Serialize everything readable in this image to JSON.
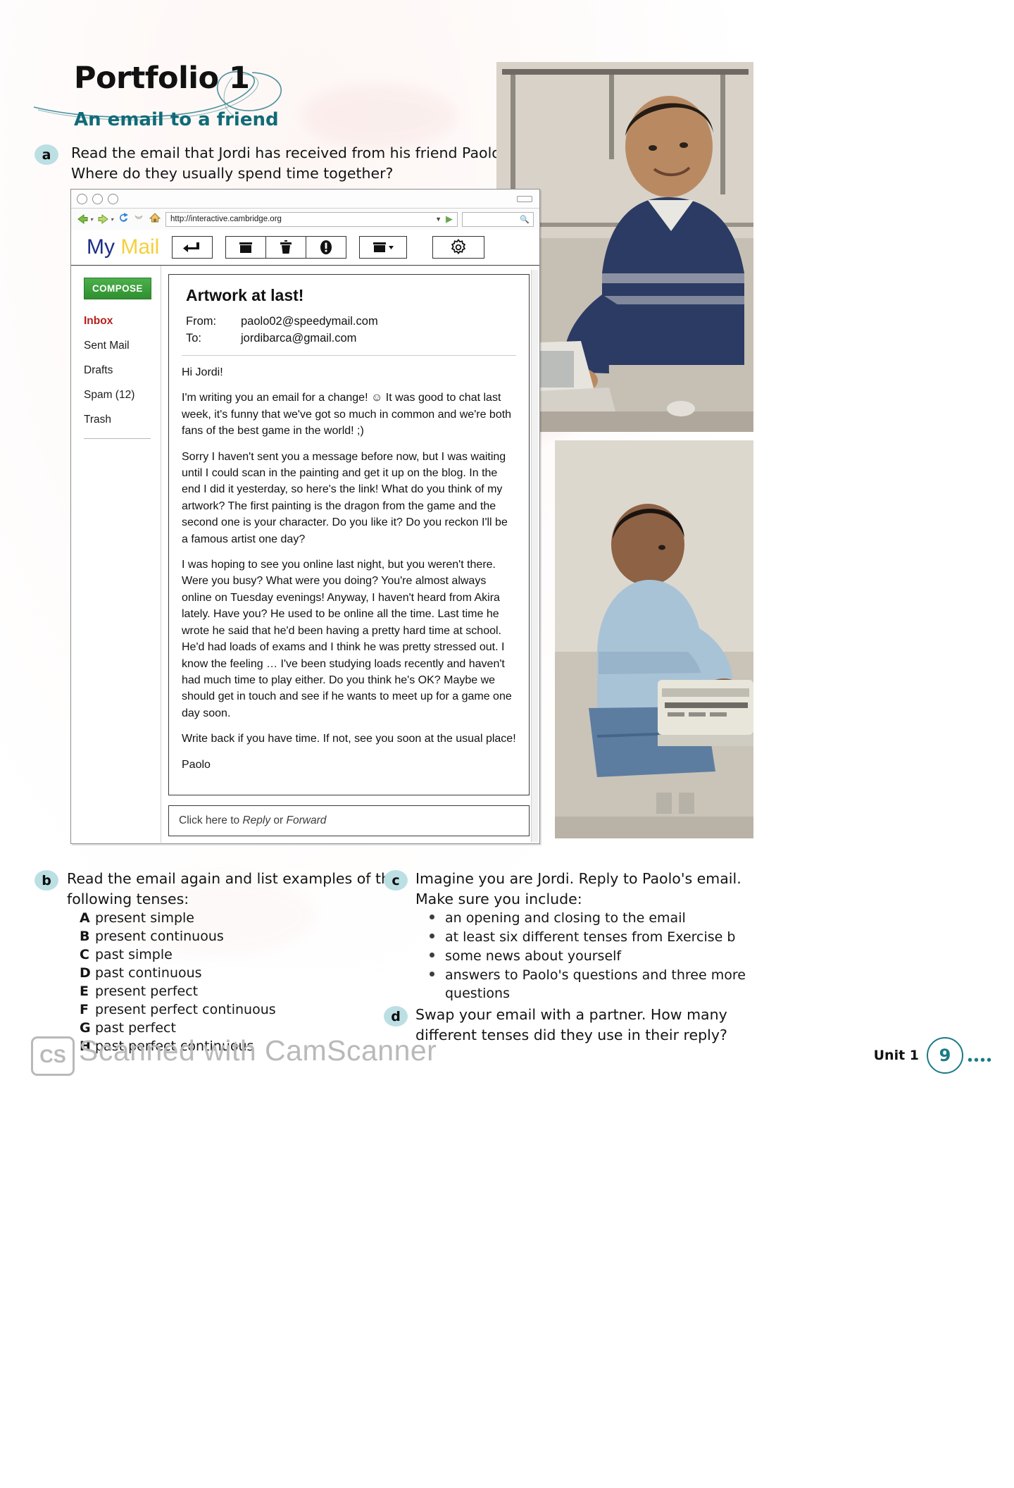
{
  "header": {
    "title": "Portfolio 1",
    "subtitle": "An email to a friend"
  },
  "exercises": {
    "a": {
      "label": "a",
      "line1": "Read the email that Jordi has received from his friend Paolo.",
      "line2": "Where do they usually spend time together?"
    },
    "b": {
      "label": "b",
      "line1": "Read the email again and list examples of the",
      "line2": "following tenses:",
      "items": [
        {
          "letter": "A",
          "text": "present simple"
        },
        {
          "letter": "B",
          "text": "present continuous"
        },
        {
          "letter": "C",
          "text": "past simple"
        },
        {
          "letter": "D",
          "text": "past continuous"
        },
        {
          "letter": "E",
          "text": "present perfect"
        },
        {
          "letter": "F",
          "text": "present perfect continuous"
        },
        {
          "letter": "G",
          "text": "past perfect"
        },
        {
          "letter": "H",
          "text": "past perfect continuous"
        }
      ]
    },
    "c": {
      "label": "c",
      "line1": "Imagine you are Jordi. Reply to Paolo's email.",
      "line2": "Make sure you include:",
      "bullets": [
        "an opening and closing to the email",
        "at least six different tenses from Exercise b",
        "some news about yourself",
        "answers to Paolo's questions and three more",
        "questions"
      ]
    },
    "d": {
      "label": "d",
      "line1": "Swap your email with a partner. How many",
      "line2": "different tenses did they use in their reply?"
    }
  },
  "browser": {
    "url": "http://interactive.cambridge.org",
    "back_icon": "back-arrow-icon",
    "forward_icon": "forward-arrow-icon",
    "reload_icon": "reload-icon",
    "stop_icon": "stop-icon",
    "home_icon": "home-icon",
    "search_icon": "search-icon",
    "url_dropdown_icon": "chevron-down-icon",
    "go_icon": "go-arrow-icon"
  },
  "mail": {
    "logo_first": "My",
    "logo_second": "Mail",
    "toolbar_buttons": [
      {
        "name": "reply-button",
        "icon": "reply-arrow-icon"
      },
      {
        "name": "archive-button",
        "icon": "archive-box-icon"
      },
      {
        "name": "delete-button",
        "icon": "trash-icon"
      },
      {
        "name": "spam-button",
        "icon": "exclamation-icon"
      },
      {
        "name": "move-to-button",
        "icon": "folder-dropdown-icon"
      },
      {
        "name": "settings-button",
        "icon": "gear-icon"
      }
    ],
    "compose_label": "COMPOSE",
    "folders": [
      {
        "label": "Inbox",
        "active": true
      },
      {
        "label": "Sent Mail",
        "active": false
      },
      {
        "label": "Drafts",
        "active": false
      },
      {
        "label": "Spam (12)",
        "active": false
      },
      {
        "label": "Trash",
        "active": false
      }
    ],
    "email": {
      "subject": "Artwork at last!",
      "from_label": "From:",
      "from_value": "paolo02@speedymail.com",
      "to_label": "To:",
      "to_value": "jordibarca@gmail.com",
      "paragraphs": [
        "Hi Jordi!",
        "I'm writing you an email for a change! ☺ It was good to chat last week, it's funny that we've got so much in common and we're both fans of the best game in the world! ;)",
        "Sorry I haven't sent you a message before now, but I was waiting until I could scan in the painting and get it up on the blog. In the end I did it yesterday, so here's the link! What do you think of my artwork? The first painting is the dragon from the game and the second one is your character. Do you like it? Do you reckon I'll be a famous artist one day?",
        "I was hoping to see you online last night, but you weren't there. Were you busy? What were you doing? You're almost always online on Tuesday evenings! Anyway, I haven't heard from Akira lately. Have you? He used to be online all the time. Last time he wrote he said that he'd been having a pretty hard time at school. He'd had loads of exams and I think he was pretty stressed out. I know the feeling … I've been studying loads recently and haven't had much time to play either. Do you think he's OK? Maybe we should get in touch and see if he wants to meet up for a game one day soon.",
        "Write back if you have time. If not, see you soon at the usual place!",
        "Paolo"
      ],
      "reply_prefix": "Click here to ",
      "reply_word": "Reply",
      "reply_middle": " or ",
      "forward_word": "Forward"
    }
  },
  "footer": {
    "watermark": "Scanned with CamScanner",
    "watermark_logo": "CS",
    "unit_label": "Unit 1",
    "page_number": "9",
    "trailing_dots": "••••"
  },
  "colors": {
    "teal": "#106b77",
    "badge": "#bcdfe4",
    "compose_green": "#39a03a",
    "inbox_red": "#b3201d",
    "logo_blue": "#1c2f86",
    "logo_yellow": "#f5cf3d"
  }
}
